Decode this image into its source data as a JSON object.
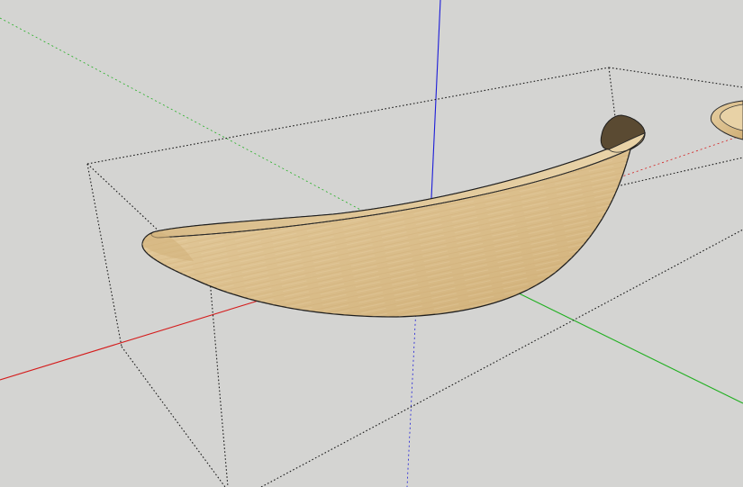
{
  "viewport": {
    "background_color": "#d4d4d2",
    "axes": {
      "red_axis_color": "#d41c1c",
      "green_axis_color": "#22b022",
      "blue_axis_color": "#1c1cd8"
    },
    "selection_box_color": "#1a1a1a",
    "material": {
      "name": "light-oak-wood",
      "base_color": "#dcc08e",
      "light_color": "#e8d2a6",
      "dark_color": "#c9a56a",
      "inner_shadow_color": "#5a4a32"
    }
  }
}
